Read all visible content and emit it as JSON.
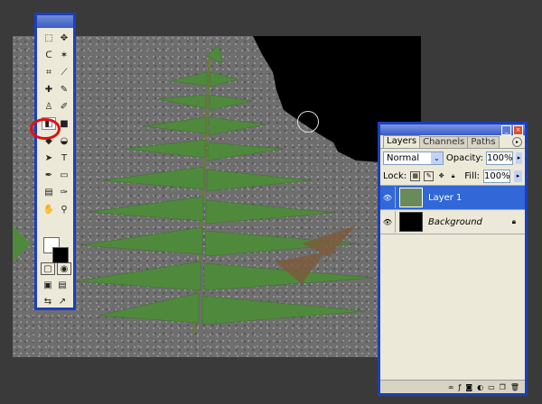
{
  "canvas": {
    "name": "fern-photo-canvas",
    "erased_color": "#000000"
  },
  "toolbox": {
    "tools": [
      {
        "name": "marquee-tool-icon",
        "glyph": "⬚"
      },
      {
        "name": "move-tool-icon",
        "glyph": "✥"
      },
      {
        "name": "lasso-tool-icon",
        "glyph": "ᑕ"
      },
      {
        "name": "magic-wand-icon",
        "glyph": "✶"
      },
      {
        "name": "crop-tool-icon",
        "glyph": "⌗"
      },
      {
        "name": "slice-tool-icon",
        "glyph": "⟋"
      },
      {
        "name": "healing-brush-icon",
        "glyph": "✚"
      },
      {
        "name": "brush-tool-icon",
        "glyph": "✎"
      },
      {
        "name": "clone-stamp-icon",
        "glyph": "♙"
      },
      {
        "name": "history-brush-icon",
        "glyph": "✐"
      },
      {
        "name": "eraser-tool-icon",
        "glyph": "◧"
      },
      {
        "name": "gradient-tool-icon",
        "glyph": "■"
      },
      {
        "name": "blur-tool-icon",
        "glyph": "◆"
      },
      {
        "name": "dodge-tool-icon",
        "glyph": "◒"
      },
      {
        "name": "path-select-icon",
        "glyph": "➤"
      },
      {
        "name": "type-tool-icon",
        "glyph": "T"
      },
      {
        "name": "pen-tool-icon",
        "glyph": "✒"
      },
      {
        "name": "shape-tool-icon",
        "glyph": "▭"
      },
      {
        "name": "notes-tool-icon",
        "glyph": "▤"
      },
      {
        "name": "eyedropper-icon",
        "glyph": "✑"
      },
      {
        "name": "hand-tool-icon",
        "glyph": "✋"
      },
      {
        "name": "zoom-tool-icon",
        "glyph": "⚲"
      }
    ]
  },
  "layers_panel": {
    "tabs": [
      "Layers",
      "Channels",
      "Paths"
    ],
    "blend_mode": "Normal",
    "opacity_label": "Opacity:",
    "opacity_value": "100%",
    "lock_label": "Lock:",
    "fill_label": "Fill:",
    "fill_value": "100%",
    "layers": [
      {
        "name": "Layer 1",
        "selected": true
      },
      {
        "name": "Background",
        "selected": false,
        "locked": true
      }
    ]
  },
  "colors": {
    "accent": "#1b3fc0",
    "highlight_ring": "#e01010",
    "selected_layer": "#3167d6"
  }
}
